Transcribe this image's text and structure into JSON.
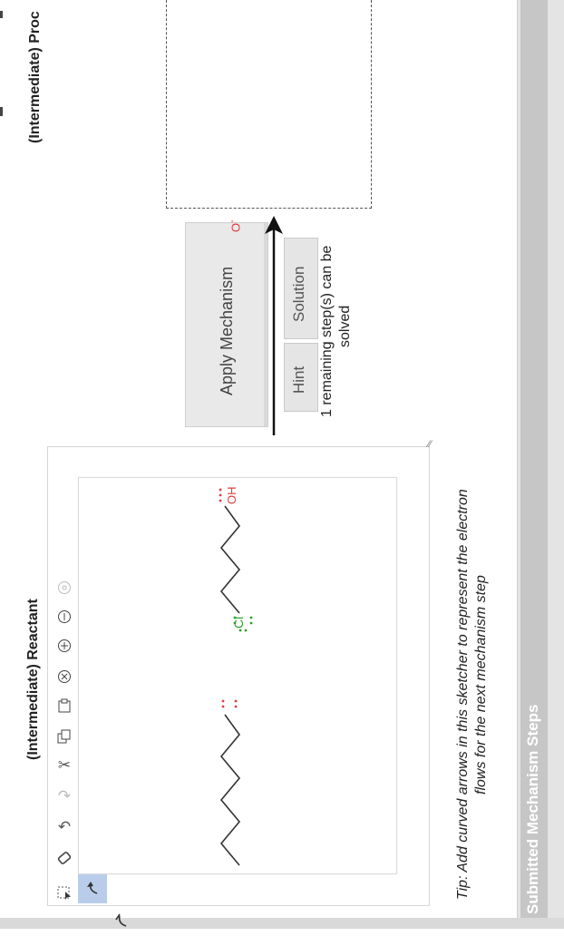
{
  "product_title": "(Intermediate) Proc",
  "reactant_title": "(Intermediate) Reactant",
  "apply_mechanism_label": "Apply Mechanism",
  "hint_label": "Hint",
  "solution_label": "Solution",
  "remaining_line1": "1 remaining step(s) can be",
  "remaining_line2": "solved",
  "tip_line1": "Tip: Add curved arrows in this sketcher to represent the electron",
  "tip_line2": "flows for the next mechanism step",
  "submitted_label": "Submitted Mechanism Steps",
  "molecule": {
    "alkoxide_atom": "O",
    "alkoxide_charge": "-",
    "chloro_atom": "Cl",
    "hydroxyl_atom": "OH"
  },
  "colors": {
    "oxygen": "#e03c3c",
    "chlorine": "#2aa12a",
    "bond": "#333333",
    "selected_tool": "#b9cdea"
  },
  "toolbar_icons": [
    "select-icon",
    "curved-arrow-single-icon",
    "curved-arrow-double-icon",
    "eraser-icon",
    "undo-icon",
    "redo-icon",
    "cut-icon",
    "copy-icon",
    "paste-icon",
    "remove-charge-icon",
    "plus-charge-icon",
    "minus-charge-icon",
    "zoom-icon"
  ]
}
